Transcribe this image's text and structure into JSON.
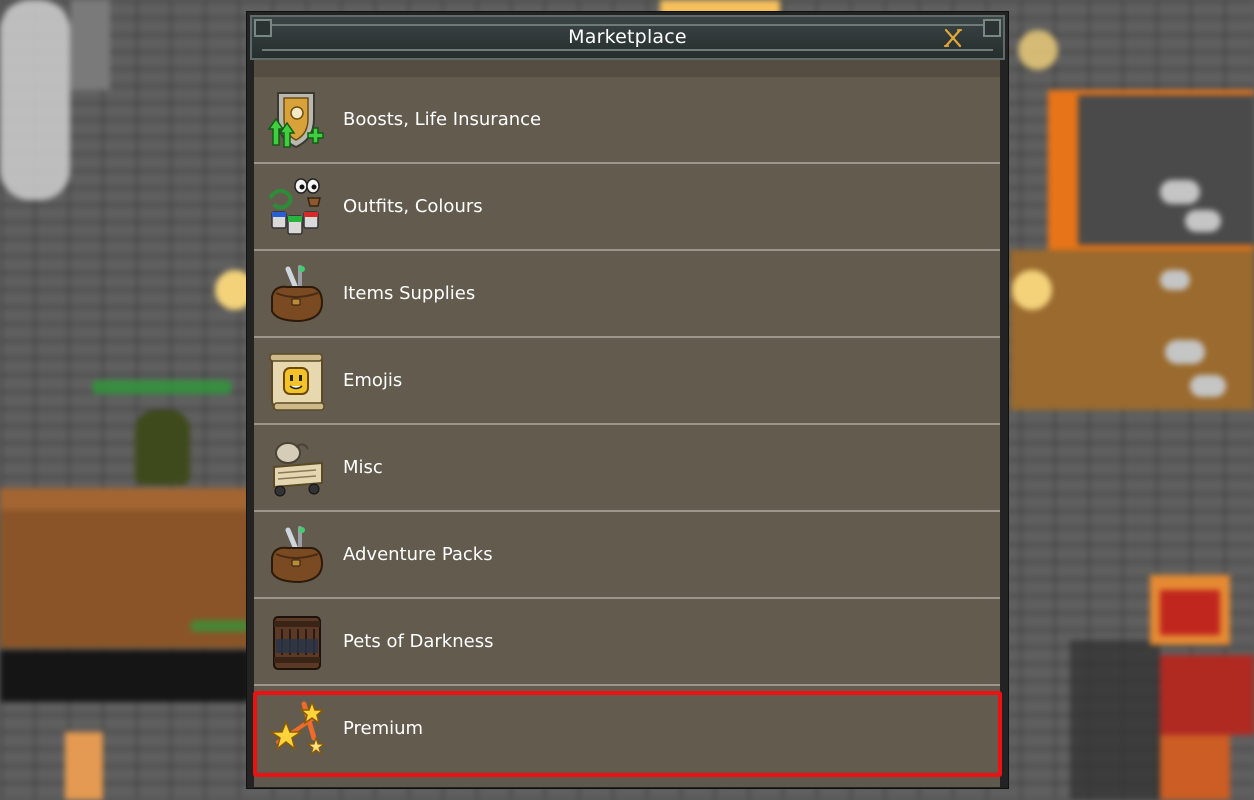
{
  "window": {
    "title": "Marketplace",
    "close_icon": "close-icon"
  },
  "categories": [
    {
      "label": "Boosts, Life Insurance",
      "icon": "shield-boost-icon"
    },
    {
      "label": "Outfits, Colours",
      "icon": "outfits-colours-icon"
    },
    {
      "label": "Items Supplies",
      "icon": "bag-sword-icon"
    },
    {
      "label": "Emojis",
      "icon": "scroll-emoji-icon"
    },
    {
      "label": "Misc",
      "icon": "misc-cart-icon"
    },
    {
      "label": "Adventure Packs",
      "icon": "bag-sword-icon"
    },
    {
      "label": "Pets of Darkness",
      "icon": "barrel-icon"
    },
    {
      "label": "Premium",
      "icon": "stars-icon"
    }
  ],
  "highlight": {
    "selected_index": 7,
    "color": "#ee1111"
  },
  "colors": {
    "panel": "#625b4f",
    "title_bar": "#2f3838",
    "accent_close": "#e0a83a"
  }
}
